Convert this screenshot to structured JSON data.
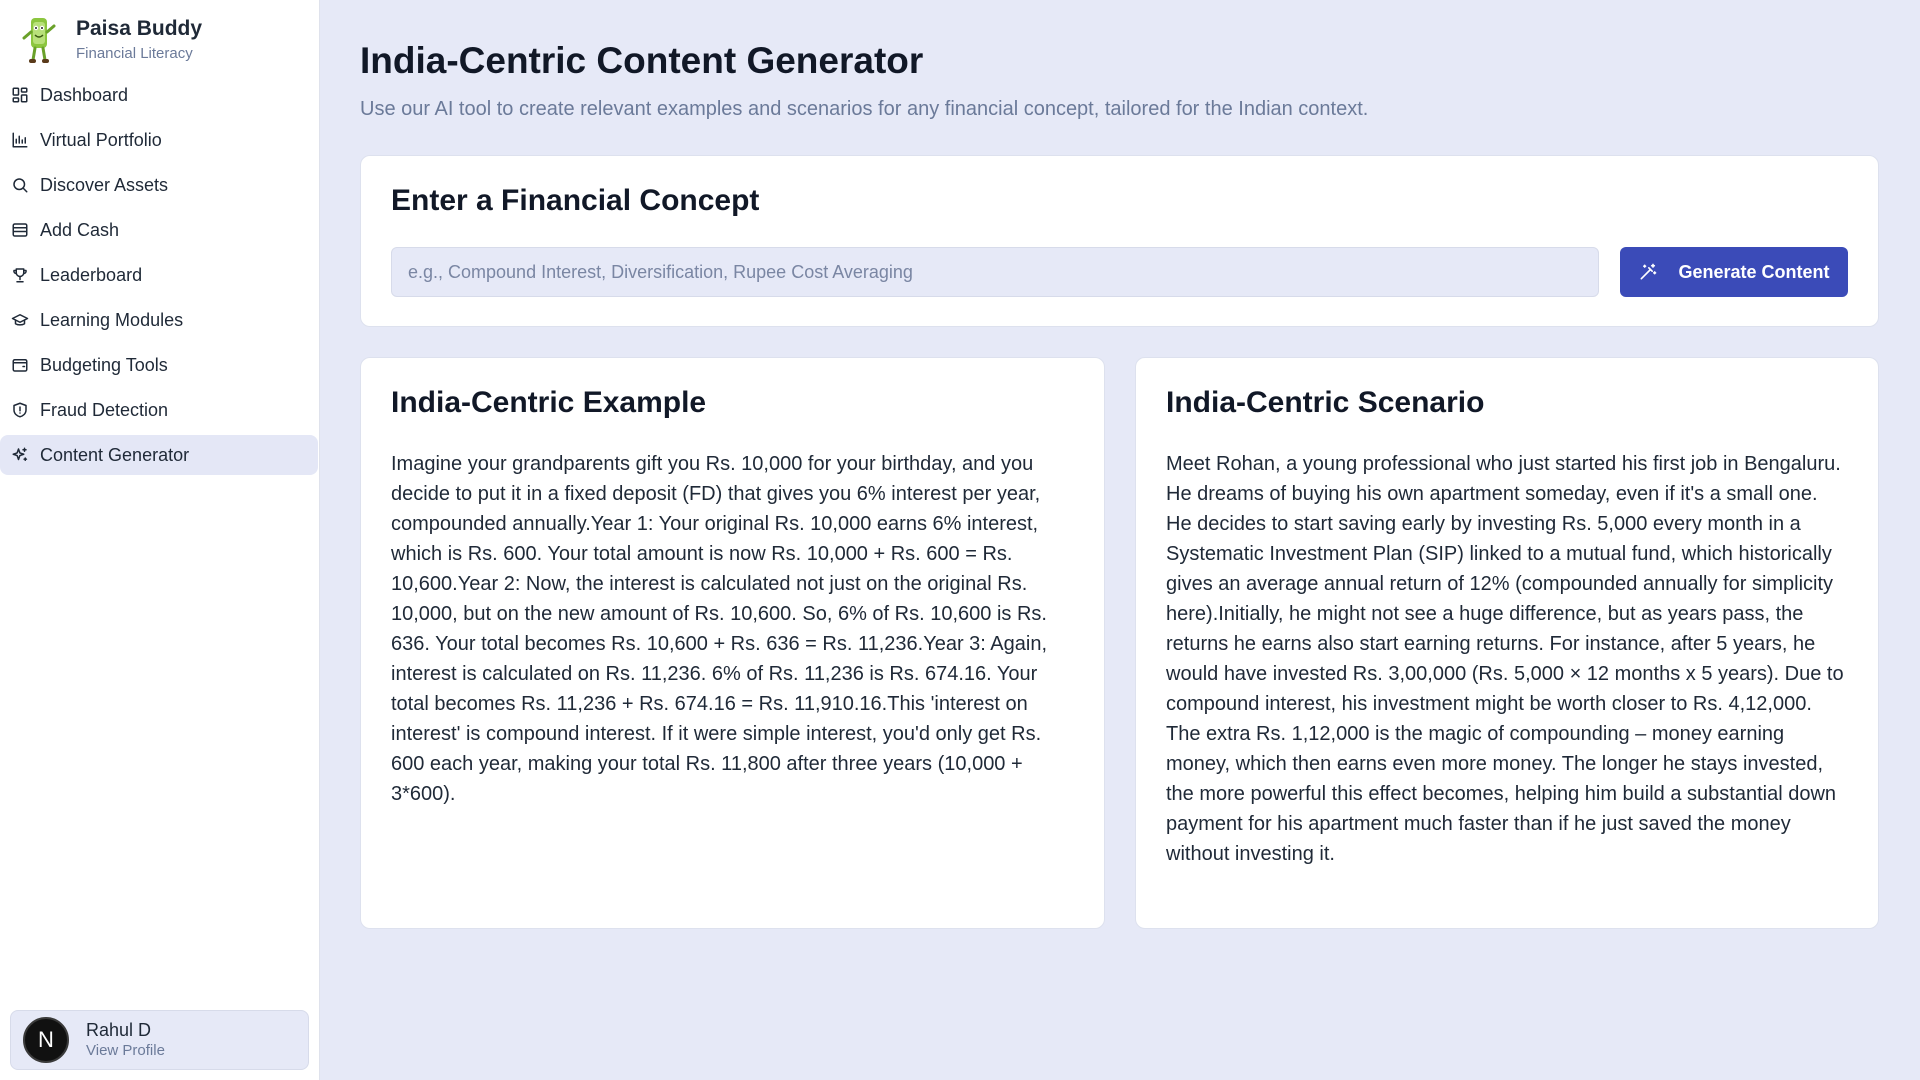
{
  "brand": {
    "title": "Paisa Buddy",
    "subtitle": "Financial Literacy"
  },
  "sidebar": {
    "items": [
      {
        "label": "Dashboard",
        "icon": "dashboard-icon",
        "active": false
      },
      {
        "label": "Virtual Portfolio",
        "icon": "chart-icon",
        "active": false
      },
      {
        "label": "Discover Assets",
        "icon": "search-icon",
        "active": false
      },
      {
        "label": "Add Cash",
        "icon": "wallet-icon",
        "active": false
      },
      {
        "label": "Leaderboard",
        "icon": "trophy-icon",
        "active": false
      },
      {
        "label": "Learning Modules",
        "icon": "graduation-cap-icon",
        "active": false
      },
      {
        "label": "Budgeting Tools",
        "icon": "wallet-card-icon",
        "active": false
      },
      {
        "label": "Fraud Detection",
        "icon": "shield-icon",
        "active": false
      },
      {
        "label": "Content Generator",
        "icon": "sparkles-icon",
        "active": true
      }
    ]
  },
  "profile": {
    "initial": "N",
    "name": "Rahul D",
    "link": "View Profile"
  },
  "header": {
    "title": "India-Centric Content Generator",
    "subtitle": "Use our AI tool to create relevant examples and scenarios for any financial concept, tailored for the Indian context."
  },
  "concept": {
    "title": "Enter a Financial Concept",
    "placeholder": "e.g., Compound Interest, Diversification, Rupee Cost Averaging",
    "value": "",
    "button_label": "Generate Content"
  },
  "example": {
    "title": "India-Centric Example",
    "body": "Imagine your grandparents gift you Rs. 10,000 for your birthday, and you decide to put it in a fixed deposit (FD) that gives you 6% interest per year, compounded annually.Year 1: Your original Rs. 10,000 earns 6% interest, which is Rs. 600. Your total amount is now Rs. 10,000 + Rs. 600 = Rs. 10,600.Year 2: Now, the interest is calculated not just on the original Rs. 10,000, but on the new amount of Rs. 10,600. So, 6% of Rs. 10,600 is Rs. 636. Your total becomes Rs. 10,600 + Rs. 636 = Rs. 11,236.Year 3: Again, interest is calculated on Rs. 11,236. 6% of Rs. 11,236 is Rs. 674.16. Your total becomes Rs. 11,236 + Rs. 674.16 = Rs. 11,910.16.This 'interest on interest' is compound interest. If it were simple interest, you'd only get Rs. 600 each year, making your total Rs. 11,800 after three years (10,000 + 3*600)."
  },
  "scenario": {
    "title": "India-Centric Scenario",
    "body": "Meet Rohan, a young professional who just started his first job in Bengaluru. He dreams of buying his own apartment someday, even if it's a small one. He decides to start saving early by investing Rs. 5,000 every month in a Systematic Investment Plan (SIP) linked to a mutual fund, which historically gives an average annual return of 12% (compounded annually for simplicity here).Initially, he might not see a huge difference, but as years pass, the returns he earns also start earning returns. For instance, after 5 years, he would have invested Rs. 3,00,000 (Rs. 5,000 × 12 months x 5 years). Due to compound interest, his investment might be worth closer to Rs. 4,12,000. The extra Rs. 1,12,000 is the magic of compounding – money earning money, which then earns even more money. The longer he stays invested, the more powerful this effect becomes, helping him build a substantial down payment for his apartment much faster than if he just saved the money without investing it."
  },
  "colors": {
    "accent": "#3b4bb8",
    "background": "#e6e9f7",
    "active_nav": "#e4e7f6"
  }
}
